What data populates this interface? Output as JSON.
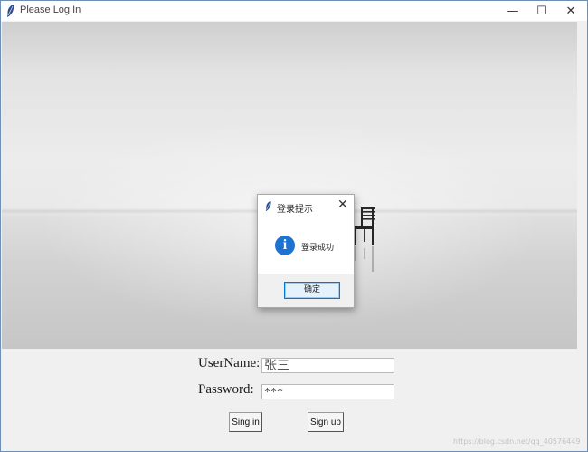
{
  "window": {
    "title": "Please Log In",
    "controls": {
      "minimize": "—",
      "maximize": "☐",
      "close": "✕"
    }
  },
  "dialog": {
    "title": "登录提示",
    "message": "登录成功",
    "ok_label": "确定",
    "close_glyph": "✕",
    "icon": "info-icon",
    "icon_glyph": "i"
  },
  "form": {
    "username_label": "UserName:",
    "username_value": "张三",
    "password_label": "Password:",
    "password_value": "***",
    "signin_label": "Sing in",
    "signup_label": "Sign up"
  },
  "watermark": "https://blog.csdn.net/qq_40576449",
  "colors": {
    "accent": "#0078d7",
    "info": "#1f73d0",
    "window_border": "#6e8fb3"
  }
}
